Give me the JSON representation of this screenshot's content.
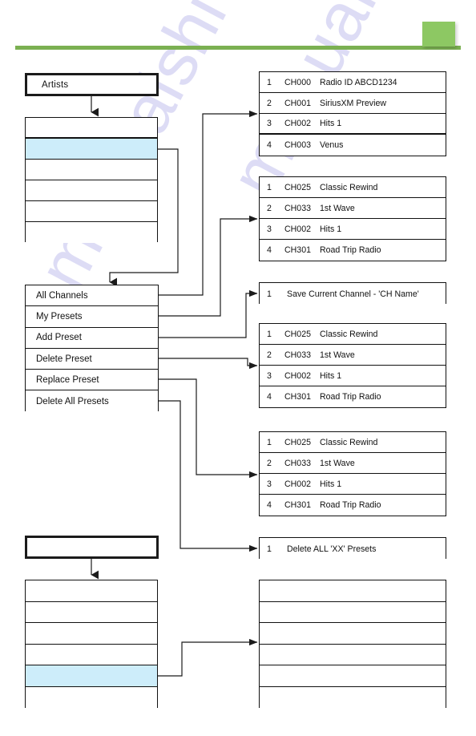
{
  "header": {
    "accent_color": "#8dc863",
    "rule_color": "#7bb052"
  },
  "watermark": {
    "line1": "manualshive.com",
    "line2": "manualshive.com"
  },
  "colors": {
    "selection_highlight": "#cdedfa",
    "outline": "#111111",
    "connector": "#1b1b1b"
  },
  "diagram": {
    "title_boxes": [
      {
        "id": "artists-title",
        "label": "Artists"
      },
      {
        "id": "bottom-title",
        "label": ""
      }
    ],
    "left_menu_upper": {
      "name": "upper-left-menu",
      "rows": [
        {
          "label": "",
          "selected": false
        },
        {
          "label": "",
          "selected": true
        },
        {
          "label": "",
          "selected": false
        },
        {
          "label": "",
          "selected": false
        },
        {
          "label": "",
          "selected": false
        },
        {
          "label": "",
          "selected": false
        }
      ]
    },
    "presets_menu": {
      "name": "presets-menu",
      "rows": [
        {
          "label": "All Channels",
          "selected": false
        },
        {
          "label": "My Presets",
          "selected": false
        },
        {
          "label": "Add Preset",
          "selected": false
        },
        {
          "label": "Delete Preset",
          "selected": false
        },
        {
          "label": "Replace Preset",
          "selected": false
        },
        {
          "label": "Delete All Presets",
          "selected": false
        }
      ]
    },
    "left_menu_lower": {
      "name": "lower-left-menu",
      "rows": [
        {
          "label": "",
          "selected": false
        },
        {
          "label": "",
          "selected": false
        },
        {
          "label": "",
          "selected": false
        },
        {
          "label": "",
          "selected": false
        },
        {
          "label": "",
          "selected": true
        },
        {
          "label": "",
          "selected": false
        }
      ]
    },
    "tables": [
      {
        "id": "all-channels-table",
        "rows": [
          {
            "index": "1",
            "channel": "CH000",
            "name": "Radio ID  ABCD1234"
          },
          {
            "index": "2",
            "channel": "CH001",
            "name": "SiriusXM Preview"
          },
          {
            "index": "3",
            "channel": "CH002",
            "name": "Hits 1"
          },
          {
            "index": "4",
            "channel": "CH003",
            "name": "Venus"
          }
        ],
        "thick_after_row": 3
      },
      {
        "id": "my-presets-table",
        "rows": [
          {
            "index": "1",
            "channel": "CH025",
            "name": "Classic Rewind"
          },
          {
            "index": "2",
            "channel": "CH033",
            "name": "1st Wave"
          },
          {
            "index": "3",
            "channel": "CH002",
            "name": "Hits 1"
          },
          {
            "index": "4",
            "channel": "CH301",
            "name": "Road Trip Radio"
          }
        ],
        "thick_after_row": 0
      },
      {
        "id": "delete-preset-table",
        "rows": [
          {
            "index": "1",
            "channel": "CH025",
            "name": "Classic Rewind"
          },
          {
            "index": "2",
            "channel": "CH033",
            "name": "1st Wave"
          },
          {
            "index": "3",
            "channel": "CH002",
            "name": "Hits 1"
          },
          {
            "index": "4",
            "channel": "CH301",
            "name": "Road Trip Radio"
          }
        ],
        "thick_after_row": 0
      },
      {
        "id": "replace-preset-table",
        "rows": [
          {
            "index": "1",
            "channel": "CH025",
            "name": "Classic Rewind"
          },
          {
            "index": "2",
            "channel": "CH033",
            "name": "1st Wave"
          },
          {
            "index": "3",
            "channel": "CH002",
            "name": "Hits 1"
          },
          {
            "index": "4",
            "channel": "CH301",
            "name": "Road Trip Radio"
          }
        ],
        "thick_after_row": 0
      }
    ],
    "single_rows": [
      {
        "id": "add-preset-row",
        "index": "1",
        "label": "Save Current Channel - 'CH Name'"
      },
      {
        "id": "delete-all-presets-row",
        "index": "1",
        "label": "Delete ALL 'XX' Presets"
      }
    ],
    "blank_table": {
      "id": "bottom-right-blank-table",
      "rows": [
        "",
        "",
        "",
        "",
        "",
        ""
      ]
    }
  }
}
